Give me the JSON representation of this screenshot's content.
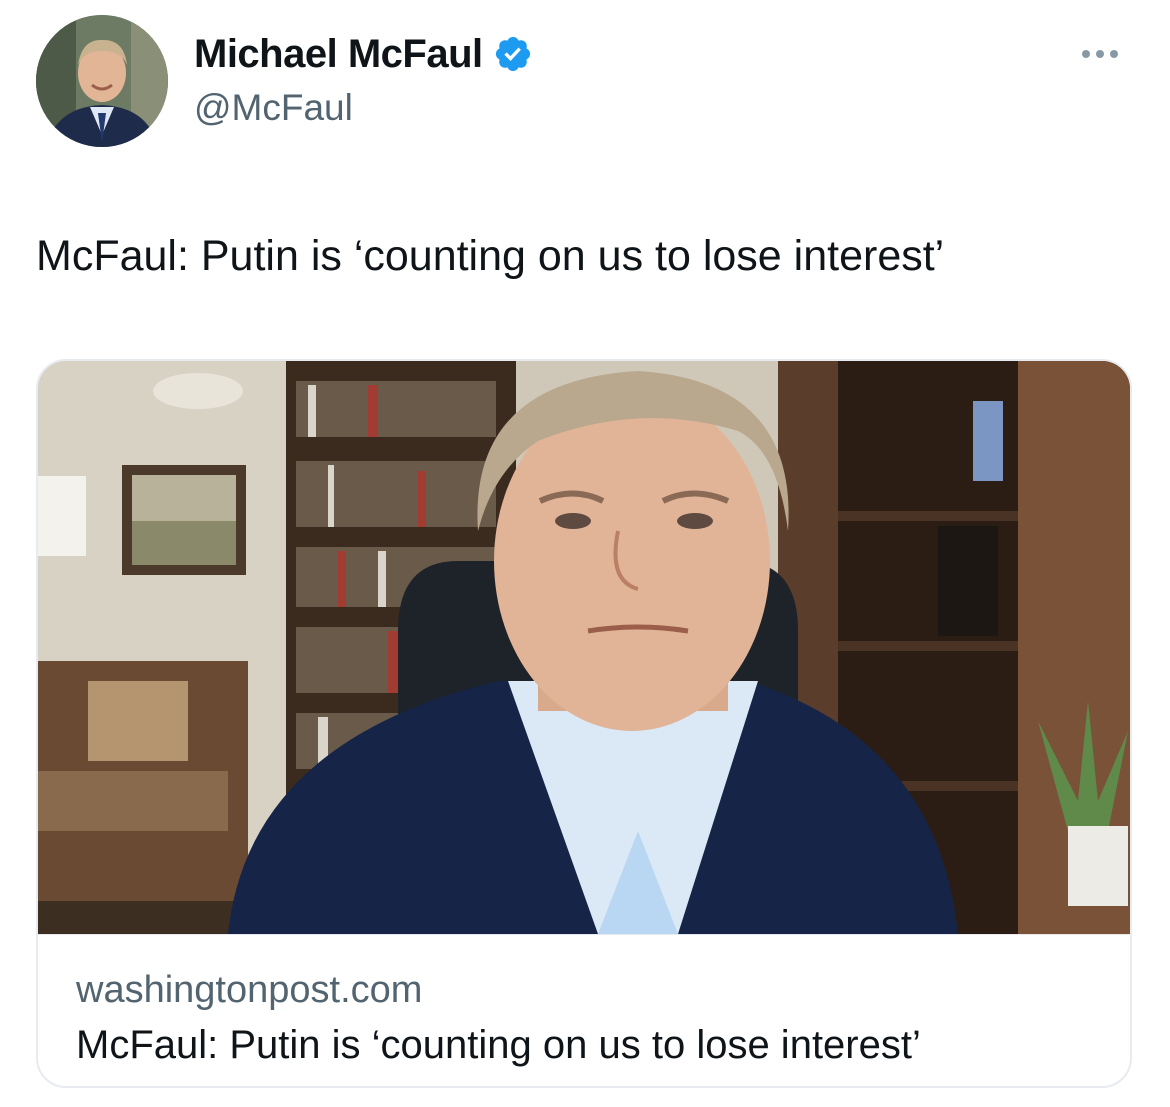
{
  "author": {
    "display_name": "Michael McFaul",
    "handle": "@McFaul",
    "verified": true,
    "verified_color": "#1d9bf0"
  },
  "tweet": {
    "text": "McFaul: Putin is ‘counting on us to lose interest’"
  },
  "link_card": {
    "domain": "washingtonpost.com",
    "title": "McFaul: Putin is ‘counting on us to lose interest’"
  },
  "icons": {
    "verified": "verified-badge-icon",
    "more": "more-options-icon"
  }
}
